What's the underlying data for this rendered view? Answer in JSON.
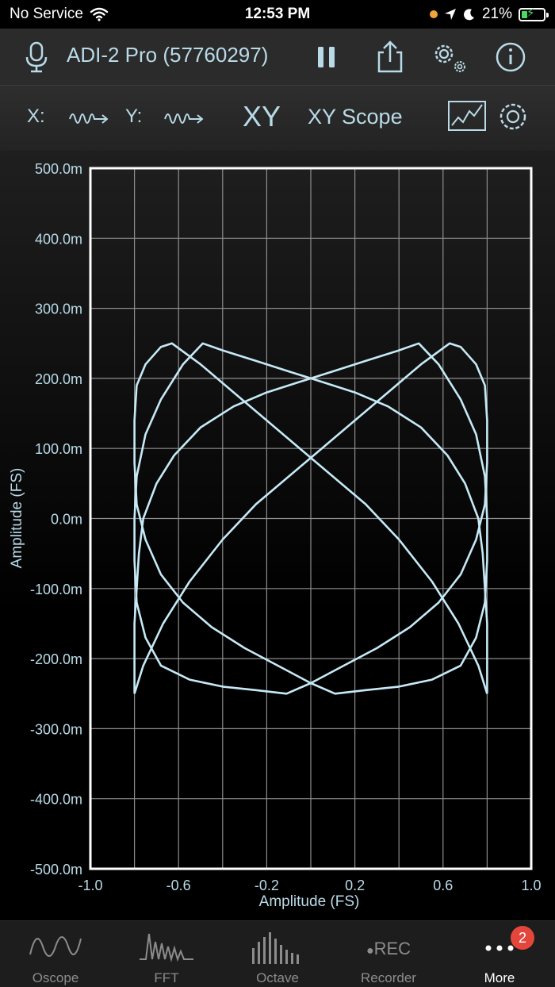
{
  "status": {
    "carrier": "No Service",
    "time": "12:53 PM",
    "battery": "21%"
  },
  "toolbar": {
    "device_name": "ADI-2 Pro (57760297)",
    "icons": [
      "microphone-icon",
      "pause-icon",
      "share-icon",
      "settings-icon",
      "info-icon"
    ]
  },
  "modebar": {
    "x_label": "X:",
    "y_label": "Y:",
    "mode_short": "XY",
    "mode_name": "XY Scope",
    "icons": [
      "waveform-arrow-icon",
      "waveform-arrow-icon",
      "chart-icon",
      "gear-icon"
    ]
  },
  "chart_data": {
    "type": "line",
    "title": "",
    "xlabel": "Amplitude (FS)",
    "ylabel": "Amplitude (FS)",
    "xlim": [
      -1.0,
      1.0
    ],
    "ylim": [
      -0.5,
      0.5
    ],
    "x_ticks": [
      "-1.0",
      "-0.6",
      "-0.2",
      "0.2",
      "0.6",
      "1.0"
    ],
    "x_tick_values": [
      -1.0,
      -0.6,
      -0.2,
      0.2,
      0.6,
      1.0
    ],
    "y_ticks": [
      "500.0m",
      "400.0m",
      "300.0m",
      "200.0m",
      "100.0m",
      "0.0m",
      "-100.0m",
      "-200.0m",
      "-300.0m",
      "-400.0m",
      "-500.0m"
    ],
    "y_tick_values": [
      0.5,
      0.4,
      0.3,
      0.2,
      0.1,
      0.0,
      -0.1,
      -0.2,
      -0.3,
      -0.4,
      -0.5
    ],
    "grid": true,
    "line_color": "#c6e9f6",
    "series": [
      {
        "points": [
          [
            -0.8,
            -0.25
          ],
          [
            -0.8,
            -0.2
          ],
          [
            -0.8,
            -0.15
          ],
          [
            -0.79,
            -0.1
          ],
          [
            -0.78,
            -0.05
          ],
          [
            -0.76,
            0.0
          ],
          [
            -0.7,
            0.05
          ],
          [
            -0.62,
            0.09
          ],
          [
            -0.5,
            0.13
          ],
          [
            -0.35,
            0.16
          ],
          [
            -0.2,
            0.18
          ],
          [
            -0.05,
            0.195
          ],
          [
            0.1,
            0.21
          ],
          [
            0.25,
            0.225
          ],
          [
            0.4,
            0.24
          ],
          [
            0.49,
            0.25
          ],
          [
            0.58,
            0.22
          ],
          [
            0.68,
            0.17
          ],
          [
            0.75,
            0.12
          ],
          [
            0.79,
            0.06
          ],
          [
            0.8,
            0.0
          ],
          [
            0.8,
            -0.06
          ],
          [
            0.79,
            -0.12
          ],
          [
            0.75,
            -0.17
          ],
          [
            0.68,
            -0.21
          ],
          [
            0.55,
            -0.23
          ],
          [
            0.4,
            -0.24
          ],
          [
            0.25,
            -0.245
          ],
          [
            0.11,
            -0.25
          ],
          [
            0.0,
            -0.235
          ],
          [
            -0.15,
            -0.21
          ],
          [
            -0.3,
            -0.185
          ],
          [
            -0.45,
            -0.155
          ],
          [
            -0.58,
            -0.12
          ],
          [
            -0.68,
            -0.08
          ],
          [
            -0.75,
            -0.03
          ],
          [
            -0.79,
            0.02
          ],
          [
            -0.8,
            0.08
          ],
          [
            -0.8,
            0.14
          ],
          [
            -0.79,
            0.19
          ],
          [
            -0.75,
            0.22
          ],
          [
            -0.68,
            0.245
          ],
          [
            -0.63,
            0.25
          ],
          [
            -0.5,
            0.22
          ],
          [
            -0.35,
            0.18
          ],
          [
            -0.2,
            0.14
          ],
          [
            -0.05,
            0.1
          ],
          [
            0.1,
            0.06
          ],
          [
            0.25,
            0.02
          ],
          [
            0.4,
            -0.03
          ],
          [
            0.55,
            -0.09
          ],
          [
            0.67,
            -0.15
          ],
          [
            0.76,
            -0.21
          ],
          [
            0.8,
            -0.25
          ]
        ]
      },
      {
        "points": [
          [
            0.8,
            -0.25
          ],
          [
            0.8,
            -0.2
          ],
          [
            0.8,
            -0.15
          ],
          [
            0.79,
            -0.1
          ],
          [
            0.78,
            -0.05
          ],
          [
            0.76,
            0.0
          ],
          [
            0.7,
            0.05
          ],
          [
            0.62,
            0.09
          ],
          [
            0.5,
            0.13
          ],
          [
            0.35,
            0.16
          ],
          [
            0.2,
            0.18
          ],
          [
            0.05,
            0.195
          ],
          [
            -0.1,
            0.21
          ],
          [
            -0.25,
            0.225
          ],
          [
            -0.4,
            0.24
          ],
          [
            -0.49,
            0.25
          ],
          [
            -0.58,
            0.22
          ],
          [
            -0.68,
            0.17
          ],
          [
            -0.75,
            0.12
          ],
          [
            -0.79,
            0.06
          ],
          [
            -0.8,
            0.0
          ],
          [
            -0.8,
            -0.06
          ],
          [
            -0.79,
            -0.12
          ],
          [
            -0.75,
            -0.17
          ],
          [
            -0.68,
            -0.21
          ],
          [
            -0.55,
            -0.23
          ],
          [
            -0.4,
            -0.24
          ],
          [
            -0.25,
            -0.245
          ],
          [
            -0.11,
            -0.25
          ],
          [
            0.0,
            -0.235
          ],
          [
            0.15,
            -0.21
          ],
          [
            0.3,
            -0.185
          ],
          [
            0.45,
            -0.155
          ],
          [
            0.58,
            -0.12
          ],
          [
            0.68,
            -0.08
          ],
          [
            0.75,
            -0.03
          ],
          [
            0.79,
            0.02
          ],
          [
            0.8,
            0.08
          ],
          [
            0.8,
            0.14
          ],
          [
            0.79,
            0.19
          ],
          [
            0.75,
            0.22
          ],
          [
            0.68,
            0.245
          ],
          [
            0.63,
            0.25
          ],
          [
            0.5,
            0.22
          ],
          [
            0.35,
            0.18
          ],
          [
            0.2,
            0.14
          ],
          [
            0.05,
            0.1
          ],
          [
            -0.1,
            0.06
          ],
          [
            -0.25,
            0.02
          ],
          [
            -0.4,
            -0.03
          ],
          [
            -0.55,
            -0.09
          ],
          [
            -0.67,
            -0.15
          ],
          [
            -0.76,
            -0.21
          ],
          [
            -0.8,
            -0.25
          ]
        ]
      }
    ]
  },
  "tabs": [
    {
      "label": "Oscope",
      "icon": "oscope-icon",
      "active": false
    },
    {
      "label": "FFT",
      "icon": "fft-icon",
      "active": false
    },
    {
      "label": "Octave",
      "icon": "octave-icon",
      "active": false
    },
    {
      "label": "Recorder",
      "icon": "rec-icon",
      "rec_text": "REC",
      "active": false
    },
    {
      "label": "More",
      "icon": "more-icon",
      "badge": "2",
      "active": true
    }
  ]
}
